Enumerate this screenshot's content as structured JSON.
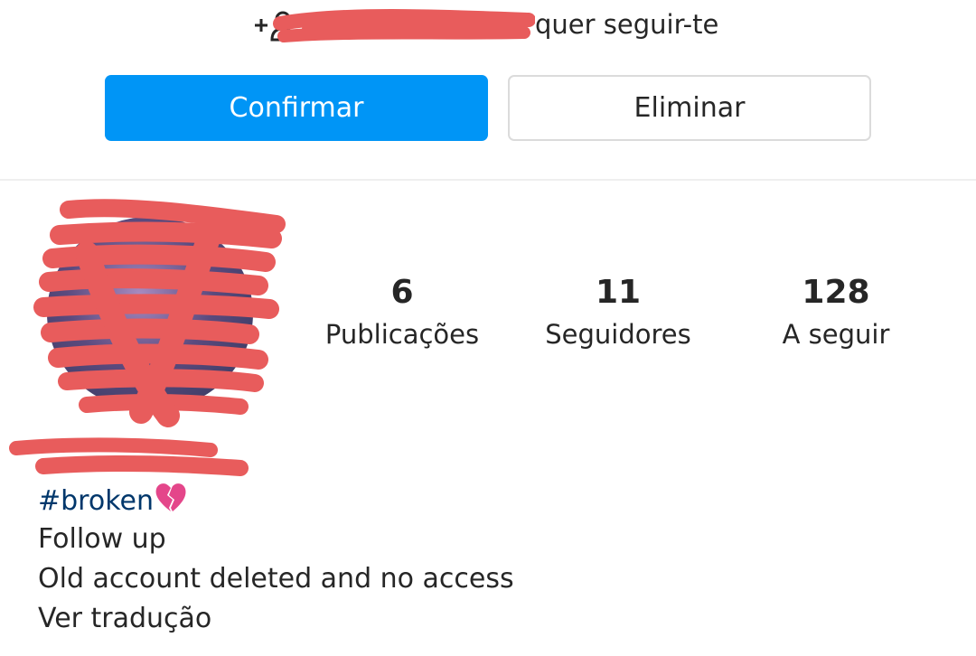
{
  "follow_request": {
    "username": "",
    "message": "quer seguir-te",
    "icon": "add-person-icon"
  },
  "actions": {
    "confirm_label": "Confirmar",
    "delete_label": "Eliminar",
    "confirm_color": "#0095f6"
  },
  "profile": {
    "avatar": "profile-photo",
    "stats": [
      {
        "value": "6",
        "label": "Publicações"
      },
      {
        "value": "11",
        "label": "Seguidores"
      },
      {
        "value": "128",
        "label": "A seguir"
      }
    ],
    "name": "",
    "bio": {
      "hashtag": "#broken",
      "hashtag_emoji": "broken-heart-icon",
      "line2": "Follow up",
      "line3": "Old account deleted and no access",
      "translate_link": "Ver tradução"
    }
  },
  "colors": {
    "redaction": "#e85c5c",
    "hashtag": "#00376b",
    "divider": "#efefef"
  }
}
